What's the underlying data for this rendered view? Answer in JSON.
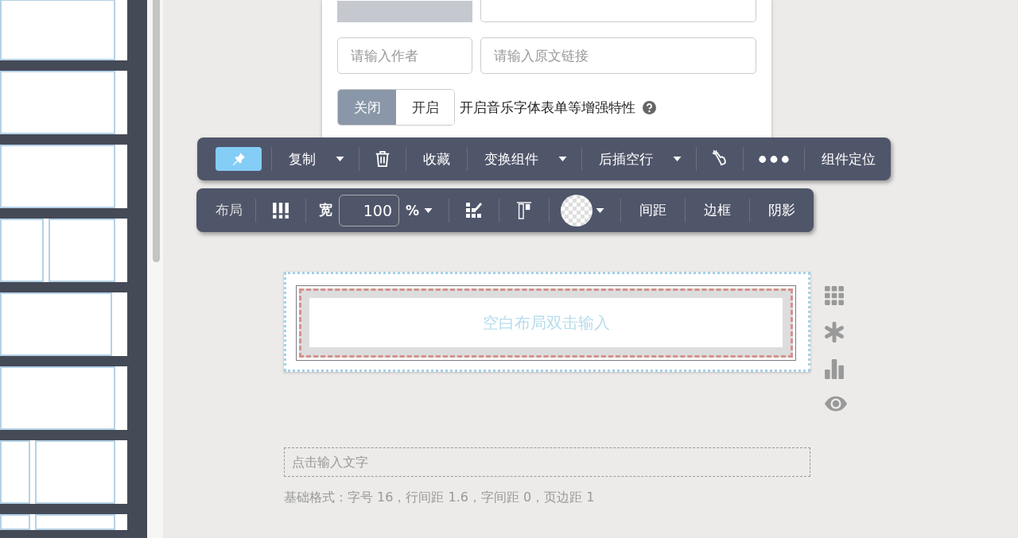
{
  "thumbnail_panel": {
    "thumbnails": [
      {
        "kind": "single"
      },
      {
        "kind": "single"
      },
      {
        "kind": "single"
      },
      {
        "kind": "double"
      },
      {
        "kind": "single-offset"
      },
      {
        "kind": "single"
      },
      {
        "kind": "double-narrow"
      },
      {
        "kind": "double-narrow"
      }
    ]
  },
  "form": {
    "author_field": {
      "placeholder": "请输入作者"
    },
    "link_field": {
      "placeholder": "请输入原文链接"
    },
    "toggle": [
      {
        "label": "关闭",
        "selected": true
      },
      {
        "label": "开启",
        "selected": false
      }
    ],
    "toggle_label": "开启音乐字体表单等增强特性"
  },
  "component_toolbar": [
    {
      "kind": "pin",
      "selected": true
    },
    {
      "kind": "text",
      "label": "复制",
      "dropdown": true
    },
    {
      "kind": "trash"
    },
    {
      "kind": "text",
      "label": "收藏",
      "dropdown": false
    },
    {
      "kind": "text",
      "label": "变换组件",
      "dropdown": true
    },
    {
      "kind": "text",
      "label": "后插空行",
      "dropdown": true
    },
    {
      "kind": "hand"
    },
    {
      "kind": "more"
    },
    {
      "kind": "text",
      "label": "组件定位",
      "dropdown": false
    }
  ],
  "style_toolbar": {
    "layout_label": "布局",
    "width_label": "宽",
    "width_value": "100",
    "unit": "%",
    "buttons": [
      "间距",
      "边框",
      "阴影"
    ]
  },
  "canvas": {
    "block_placeholder": "空白布局双击输入",
    "text_placeholder": "点击输入文字",
    "format_info": "基础格式：字号 16，行间距 1.6，字间距 0，页边距 1"
  }
}
